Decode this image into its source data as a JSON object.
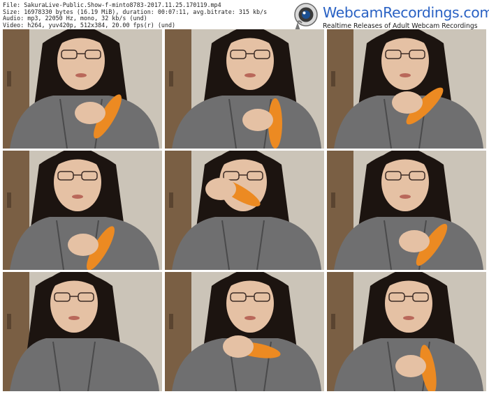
{
  "file_info": {
    "lines": [
      "File: SakuraLive-Public.Show-f-minto8783-2017.11.25.170119.mp4",
      "Size: 16978330 bytes (16.19 MiB), duration: 00:07:11, avg.bitrate: 315 kb/s",
      "Audio: mp3, 22050 Hz, mono, 32 kb/s (und)",
      "Video: h264, yuv420p, 512x384, 20.00 fps(r) (und)"
    ]
  },
  "brand": {
    "title": "WebcamRecordings.com",
    "tagline": "Realtime Releases of Adult Webcam Recordings",
    "icon": "webcam-icon"
  },
  "colors": {
    "brand_blue": "#2a62c4",
    "background": "#ffffff",
    "wall": "#cbc4b8",
    "sweater": "#6f6f70",
    "hair": "#1c1410",
    "skin": "#e5c1a4",
    "carrot": "#ec8a22"
  },
  "thumbnails": [
    {
      "name": "thumbnail-1"
    },
    {
      "name": "thumbnail-2"
    },
    {
      "name": "thumbnail-3"
    },
    {
      "name": "thumbnail-4"
    },
    {
      "name": "thumbnail-5"
    },
    {
      "name": "thumbnail-6"
    },
    {
      "name": "thumbnail-7"
    },
    {
      "name": "thumbnail-8"
    },
    {
      "name": "thumbnail-9"
    }
  ]
}
